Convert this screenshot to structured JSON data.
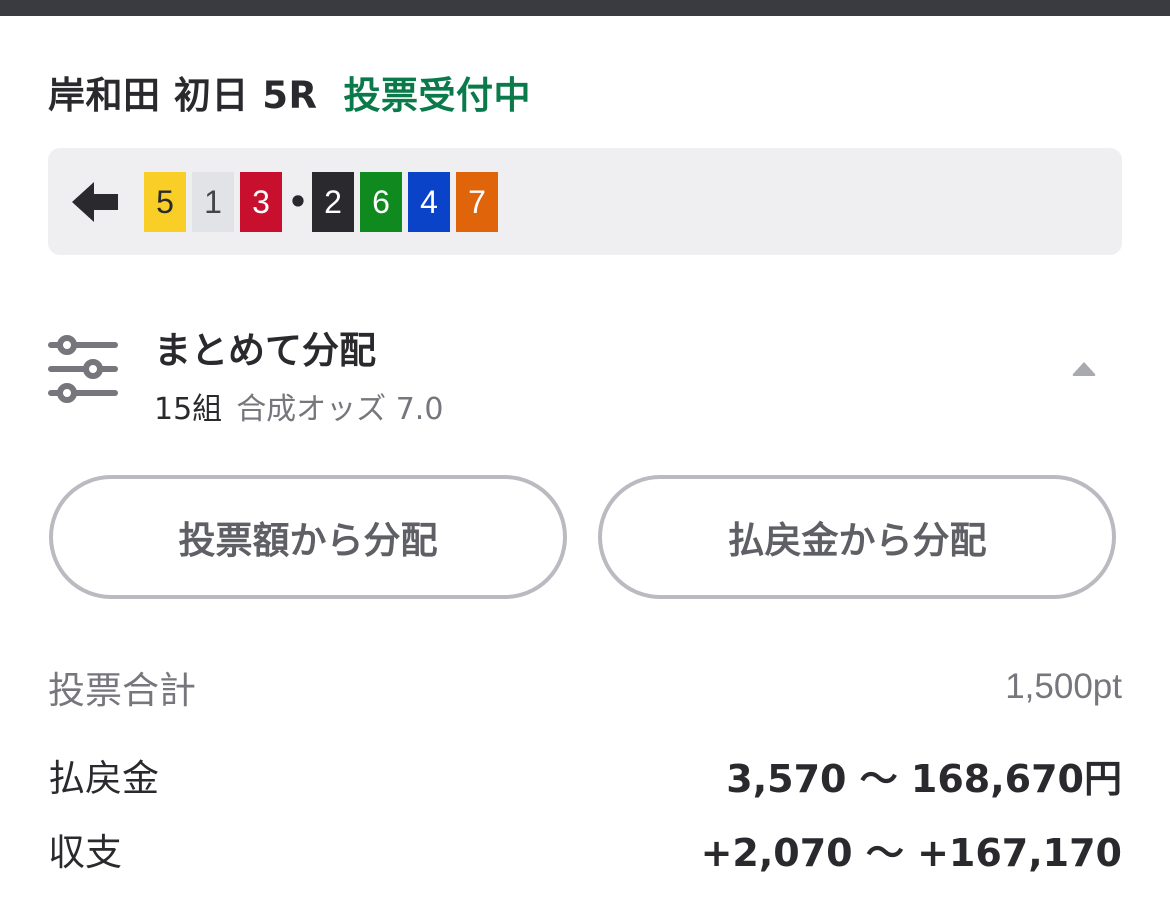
{
  "header": {
    "race_name": "岸和田 初日 5R",
    "status": "投票受付中",
    "status_color": "#0a7a4a"
  },
  "combination": {
    "icon": "arrow-left-icon",
    "numbers": [
      {
        "value": "5",
        "bg": "#f9cf27",
        "fg": "#2a2a2e"
      },
      {
        "value": "1",
        "bg": "#e2e3e6",
        "fg": "#44454a"
      },
      {
        "value": "3",
        "bg": "#c8102e",
        "fg": "#ffffff"
      },
      {
        "value": "•",
        "separator": true
      },
      {
        "value": "2",
        "bg": "#2a2a2e",
        "fg": "#ffffff"
      },
      {
        "value": "6",
        "bg": "#0f8a1e",
        "fg": "#ffffff"
      },
      {
        "value": "4",
        "bg": "#0a43c8",
        "fg": "#ffffff"
      },
      {
        "value": "7",
        "bg": "#e0640a",
        "fg": "#ffffff"
      }
    ]
  },
  "distribution": {
    "icon": "sliders-icon",
    "title": "まとめて分配",
    "count": "15組",
    "odds": "合成オッズ 7.0",
    "toggle_icon": "caret-up-icon"
  },
  "buttons": {
    "by_bet": "投票額から分配",
    "by_payout": "払戻金から分配"
  },
  "summary": {
    "total_label": "投票合計",
    "total_value": "1,500pt",
    "payout_label": "払戻金",
    "payout_value": "3,570 〜 168,670円",
    "balance_label": "収支",
    "balance_value": "+2,070 〜 +167,170"
  }
}
